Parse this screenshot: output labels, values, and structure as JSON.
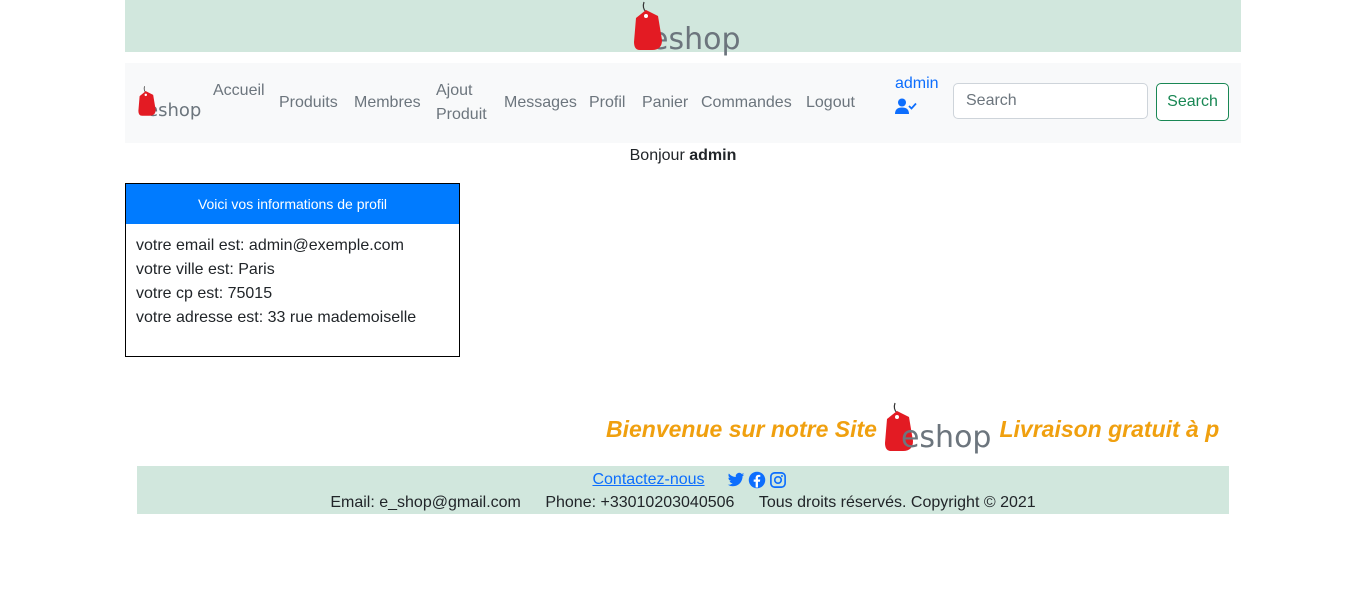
{
  "brand": {
    "logo_text": "eshop"
  },
  "nav": {
    "links": [
      {
        "label_line1": "Accueil"
      },
      {
        "label": "Produits"
      },
      {
        "label": "Membres"
      },
      {
        "label_line1": "Ajout",
        "label_line2": "Produit"
      },
      {
        "label": "Messages"
      },
      {
        "label": "Profil"
      },
      {
        "label": "Panier"
      },
      {
        "label": "Commandes"
      },
      {
        "label": "Logout"
      }
    ],
    "user": "admin",
    "search_placeholder": "Search",
    "search_button": "Search"
  },
  "greeting": {
    "prefix": "Bonjour",
    "name": "admin"
  },
  "profile": {
    "header": "Voici vos informations de profil",
    "lines": [
      "votre email est: admin@exemple.com",
      "votre ville est: Paris",
      "votre cp est: 75015",
      "votre adresse est: 33 rue mademoiselle"
    ]
  },
  "marquee": {
    "text_left": "Bienvenue sur notre Site",
    "text_right": "Livraison gratuit à p"
  },
  "footer": {
    "contact": "Contactez-nous",
    "email": "Email: e_shop@gmail.com",
    "phone": "Phone: +33010203040506",
    "copyright": "Tous droits réservés. Copyright © 2021"
  },
  "colors": {
    "banner": "#d1e7dd",
    "accent": "#007bff",
    "marquee": "#f0a00f",
    "search": "#198754",
    "logo_tag": "#e31b23"
  },
  "icons": [
    "shopping-tag-icon",
    "user-check-icon",
    "twitter-icon",
    "facebook-icon",
    "instagram-icon"
  ]
}
